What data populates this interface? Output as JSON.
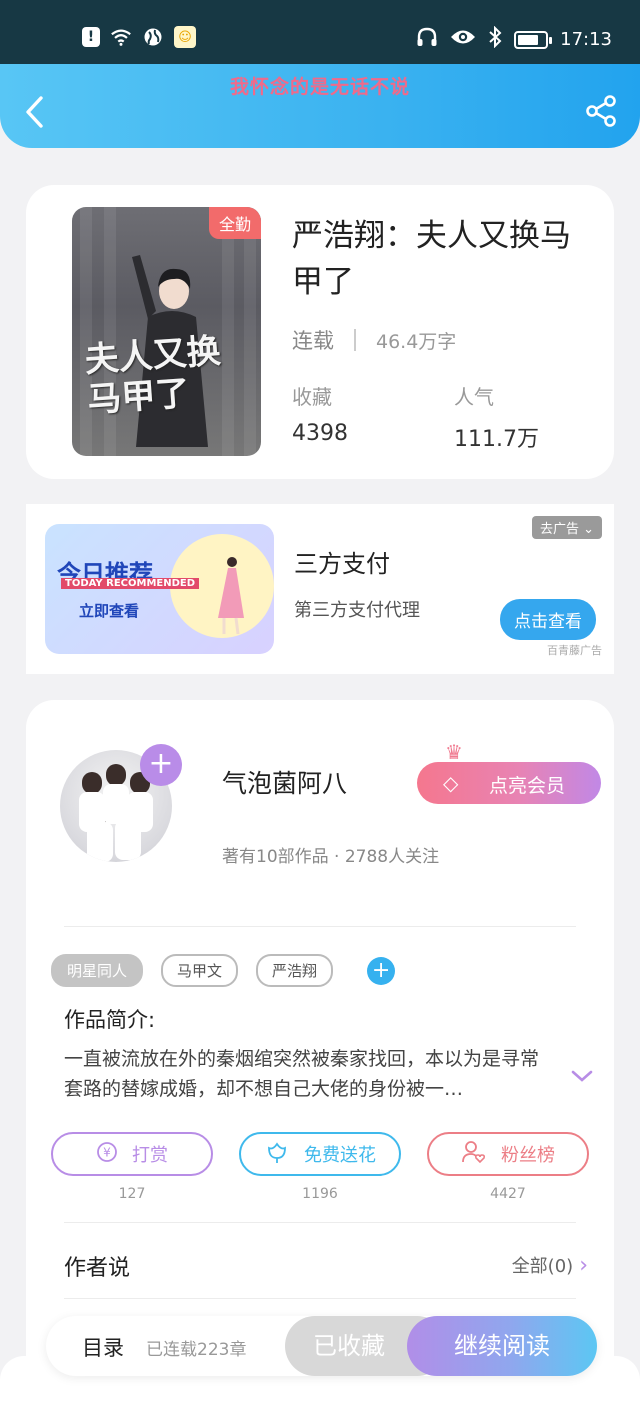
{
  "status_bar": {
    "time": "17:13",
    "battery_level": 0.75
  },
  "header": {
    "title": "我怀念的是无话不说"
  },
  "book": {
    "badge": "全勤",
    "cover_title": "夫人又换马甲了",
    "title": "严浩翔：夫人又换马甲了",
    "status": "连载",
    "words": "46.4万字",
    "collect_label": "收藏",
    "collect_value": "4398",
    "popularity_label": "人气",
    "popularity_value": "111.7万"
  },
  "ad": {
    "image_line1": "今日推荐",
    "image_line2": "TODAY RECOMMENDED",
    "image_line3": "立即查看",
    "title": "三方支付",
    "description": "第三方支付代理",
    "close_label": "去广告",
    "cta_label": "点击查看",
    "source": "百青藤广告"
  },
  "author": {
    "name": "气泡菌阿八",
    "stats": "著有10部作品 · 2788人关注",
    "vip_label": "点亮会员"
  },
  "tags": [
    "明星同人",
    "马甲文",
    "严浩翔"
  ],
  "intro": {
    "label": "作品简介:",
    "text": "一直被流放在外的秦烟绾突然被秦家找回，本以为是寻常套路的替嫁成婚，却不想自己大佬的身份被一…"
  },
  "actions": [
    {
      "label": "打赏",
      "count": "127",
      "color": "#b88de6"
    },
    {
      "label": "免费送花",
      "count": "1196",
      "color": "#3fb9ec"
    },
    {
      "label": "粉丝榜",
      "count": "4427",
      "color": "#ec7e86"
    }
  ],
  "author_say": {
    "label": "作者说",
    "all_label": "全部(0)"
  },
  "bottom_bar": {
    "toc_label": "目录",
    "toc_count": "已连载223章",
    "collected_label": "已收藏",
    "read_label": "继续阅读"
  }
}
